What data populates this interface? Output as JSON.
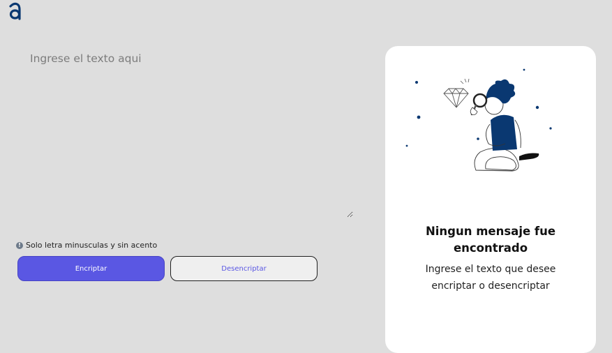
{
  "logo": {
    "icon": "alura-logo-icon",
    "color": "#0a3871"
  },
  "input": {
    "placeholder": "Ingrese el texto aqui",
    "value": ""
  },
  "hint": {
    "icon": "info-icon",
    "text": "Solo letra minusculas y sin acento"
  },
  "buttons": {
    "encrypt_label": "Encriptar",
    "decrypt_label": "Desencriptar"
  },
  "result": {
    "illustration": "person-with-magnifying-glass-illustration",
    "title_line1": "Ningun mensaje fue",
    "title_line2": "encontrado",
    "text_line1": "Ingrese el texto que desee",
    "text_line2": "encriptar o desencriptar"
  },
  "colors": {
    "background": "#dedede",
    "accent": "#5a57e3",
    "panel": "#ffffff",
    "brand_dark": "#0a3871"
  }
}
